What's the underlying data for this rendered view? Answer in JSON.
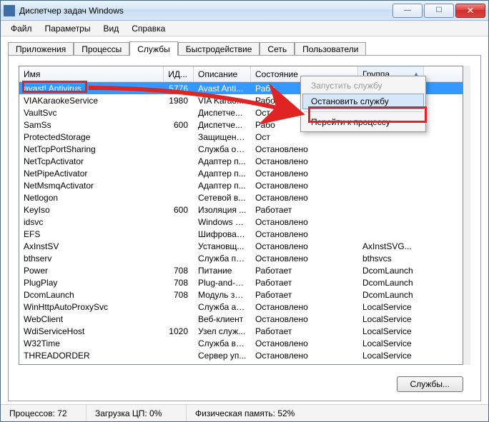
{
  "window": {
    "title": "Диспетчер задач Windows"
  },
  "menubar": {
    "items": [
      "Файл",
      "Параметры",
      "Вид",
      "Справка"
    ]
  },
  "tabs": {
    "items": [
      "Приложения",
      "Процессы",
      "Службы",
      "Быстродействие",
      "Сеть",
      "Пользователи"
    ],
    "active_index": 2
  },
  "columns": {
    "name": "Имя",
    "id": "ИД...",
    "desc": "Описание",
    "state": "Состояние",
    "group": "Группа"
  },
  "context_menu": {
    "start": "Запустить службу",
    "stop": "Остановить службу",
    "goto": "Перейти к процессу"
  },
  "services_button": "Службы...",
  "statusbar": {
    "processes": "Процессов: 72",
    "cpu": "Загрузка ЦП: 0%",
    "memory": "Физическая память: 52%"
  },
  "rows": [
    {
      "name": "avast! Antivirus",
      "id": "5776",
      "desc": "Avast Anti...",
      "state": "Рабо",
      "group": "",
      "sel": true
    },
    {
      "name": "VIAKaraokeService",
      "id": "1980",
      "desc": "VIA Karao...",
      "state": "Рабо",
      "group": ""
    },
    {
      "name": "VaultSvc",
      "id": "",
      "desc": "Диспетче...",
      "state": "Ост",
      "group": ""
    },
    {
      "name": "SamSs",
      "id": "600",
      "desc": "Диспетче...",
      "state": "Рабо",
      "group": ""
    },
    {
      "name": "ProtectedStorage",
      "id": "",
      "desc": "Защищенн...",
      "state": "Ост",
      "group": ""
    },
    {
      "name": "NetTcpPortSharing",
      "id": "",
      "desc": "Служба об...",
      "state": "Остановлено",
      "group": ""
    },
    {
      "name": "NetTcpActivator",
      "id": "",
      "desc": "Адаптер п...",
      "state": "Остановлено",
      "group": ""
    },
    {
      "name": "NetPipeActivator",
      "id": "",
      "desc": "Адаптер п...",
      "state": "Остановлено",
      "group": ""
    },
    {
      "name": "NetMsmqActivator",
      "id": "",
      "desc": "Адаптер п...",
      "state": "Остановлено",
      "group": ""
    },
    {
      "name": "Netlogon",
      "id": "",
      "desc": "Сетевой в...",
      "state": "Остановлено",
      "group": ""
    },
    {
      "name": "KeyIso",
      "id": "600",
      "desc": "Изоляция ...",
      "state": "Работает",
      "group": ""
    },
    {
      "name": "idsvc",
      "id": "",
      "desc": "Windows C...",
      "state": "Остановлено",
      "group": ""
    },
    {
      "name": "EFS",
      "id": "",
      "desc": "Шифрован...",
      "state": "Остановлено",
      "group": ""
    },
    {
      "name": "AxInstSV",
      "id": "",
      "desc": "Установщ...",
      "state": "Остановлено",
      "group": "AxInstSVG..."
    },
    {
      "name": "bthserv",
      "id": "",
      "desc": "Служба по...",
      "state": "Остановлено",
      "group": "bthsvcs"
    },
    {
      "name": "Power",
      "id": "708",
      "desc": "Питание",
      "state": "Работает",
      "group": "DcomLaunch"
    },
    {
      "name": "PlugPlay",
      "id": "708",
      "desc": "Plug-and-Play",
      "state": "Работает",
      "group": "DcomLaunch"
    },
    {
      "name": "DcomLaunch",
      "id": "708",
      "desc": "Модуль за...",
      "state": "Работает",
      "group": "DcomLaunch"
    },
    {
      "name": "WinHttpAutoProxySvc",
      "id": "",
      "desc": "Служба ав...",
      "state": "Остановлено",
      "group": "LocalService"
    },
    {
      "name": "WebClient",
      "id": "",
      "desc": "Веб-клиент",
      "state": "Остановлено",
      "group": "LocalService"
    },
    {
      "name": "WdiServiceHost",
      "id": "1020",
      "desc": "Узел служ...",
      "state": "Работает",
      "group": "LocalService"
    },
    {
      "name": "W32Time",
      "id": "",
      "desc": "Служба вр...",
      "state": "Остановлено",
      "group": "LocalService"
    },
    {
      "name": "THREADORDER",
      "id": "",
      "desc": "Сервер уп...",
      "state": "Остановлено",
      "group": "LocalService"
    }
  ]
}
